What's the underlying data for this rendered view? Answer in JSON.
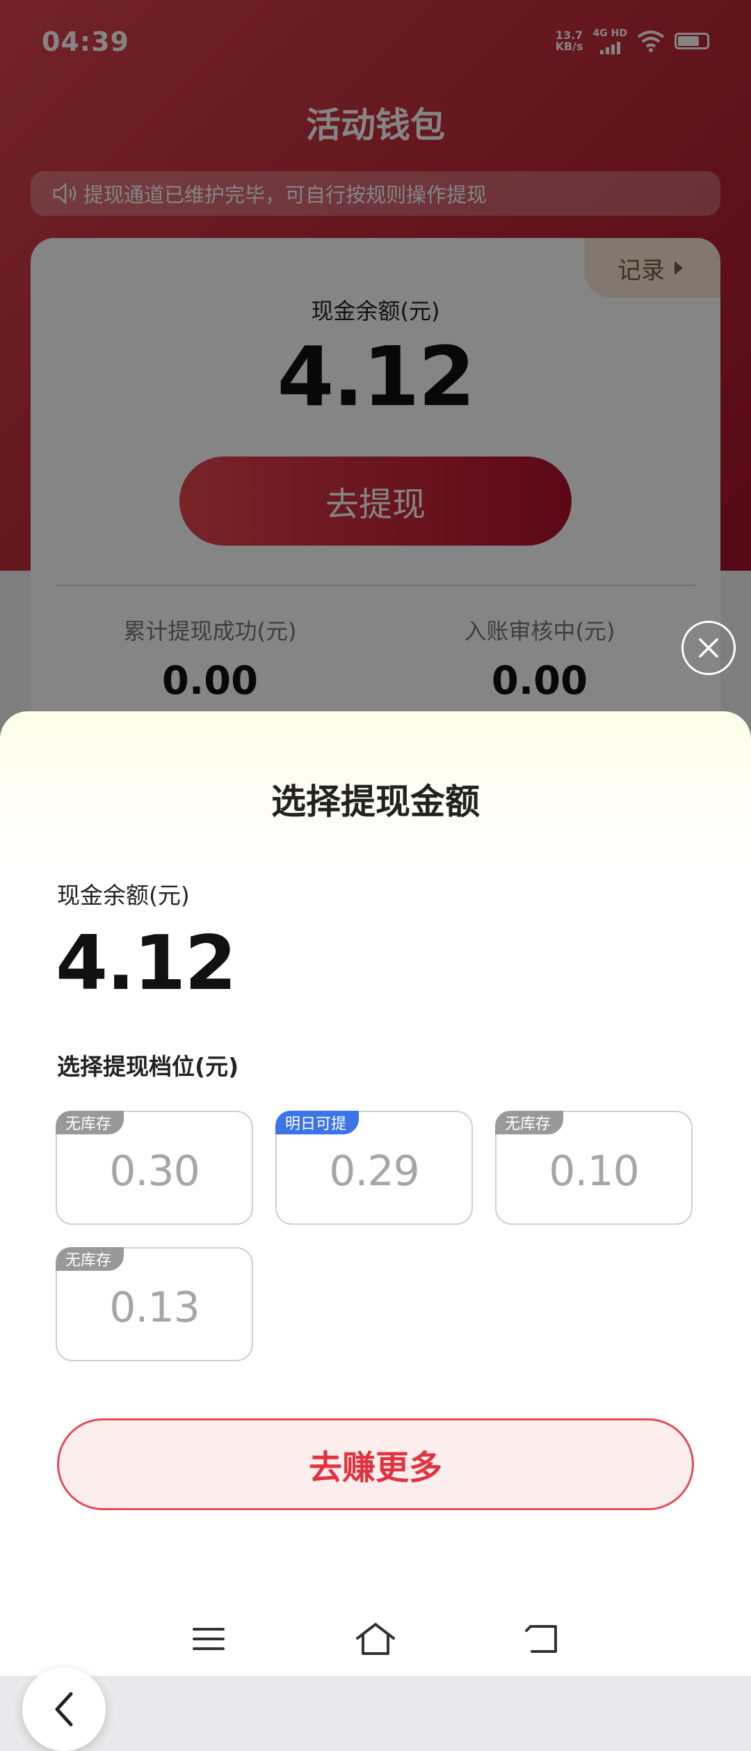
{
  "status_bar": {
    "time": "04:39",
    "net_speed_value": "13.7",
    "net_speed_unit": "KB/s",
    "network_type": "4G HD"
  },
  "wallet": {
    "title": "活动钱包",
    "notice": "提现通道已维护完毕，可自行按规则操作提现",
    "records_label": "记录",
    "balance_label": "现金余额(元)",
    "balance": "4.12",
    "withdraw_button": "去提现",
    "stats": [
      {
        "label": "累计提现成功(元)",
        "value": "0.00"
      },
      {
        "label": "入账审核中(元)",
        "value": "0.00"
      }
    ]
  },
  "sheet": {
    "title": "选择提现金额",
    "balance_label": "现金余额(元)",
    "balance": "4.12",
    "tier_label": "选择提现档位(元)",
    "tiers": [
      {
        "badge": "无库存",
        "badge_color": "#999999",
        "amount": "0.30"
      },
      {
        "badge": "明日可提",
        "badge_color": "#3b74e4",
        "amount": "0.29"
      },
      {
        "badge": "无库存",
        "badge_color": "#999999",
        "amount": "0.10"
      },
      {
        "badge": "无库存",
        "badge_color": "#999999",
        "amount": "0.13"
      }
    ],
    "earn_more_button": "去赚更多"
  },
  "colors": {
    "brand_red": "#c5303e",
    "accent_blue": "#3b74e4",
    "earn_button_text": "#e0323f"
  },
  "icons": [
    "speaker-icon",
    "caret-right-icon",
    "close-icon",
    "back-chevron-icon",
    "menu-icon",
    "home-icon",
    "back-icon",
    "wifi-icon",
    "battery-icon",
    "signal-icon"
  ]
}
